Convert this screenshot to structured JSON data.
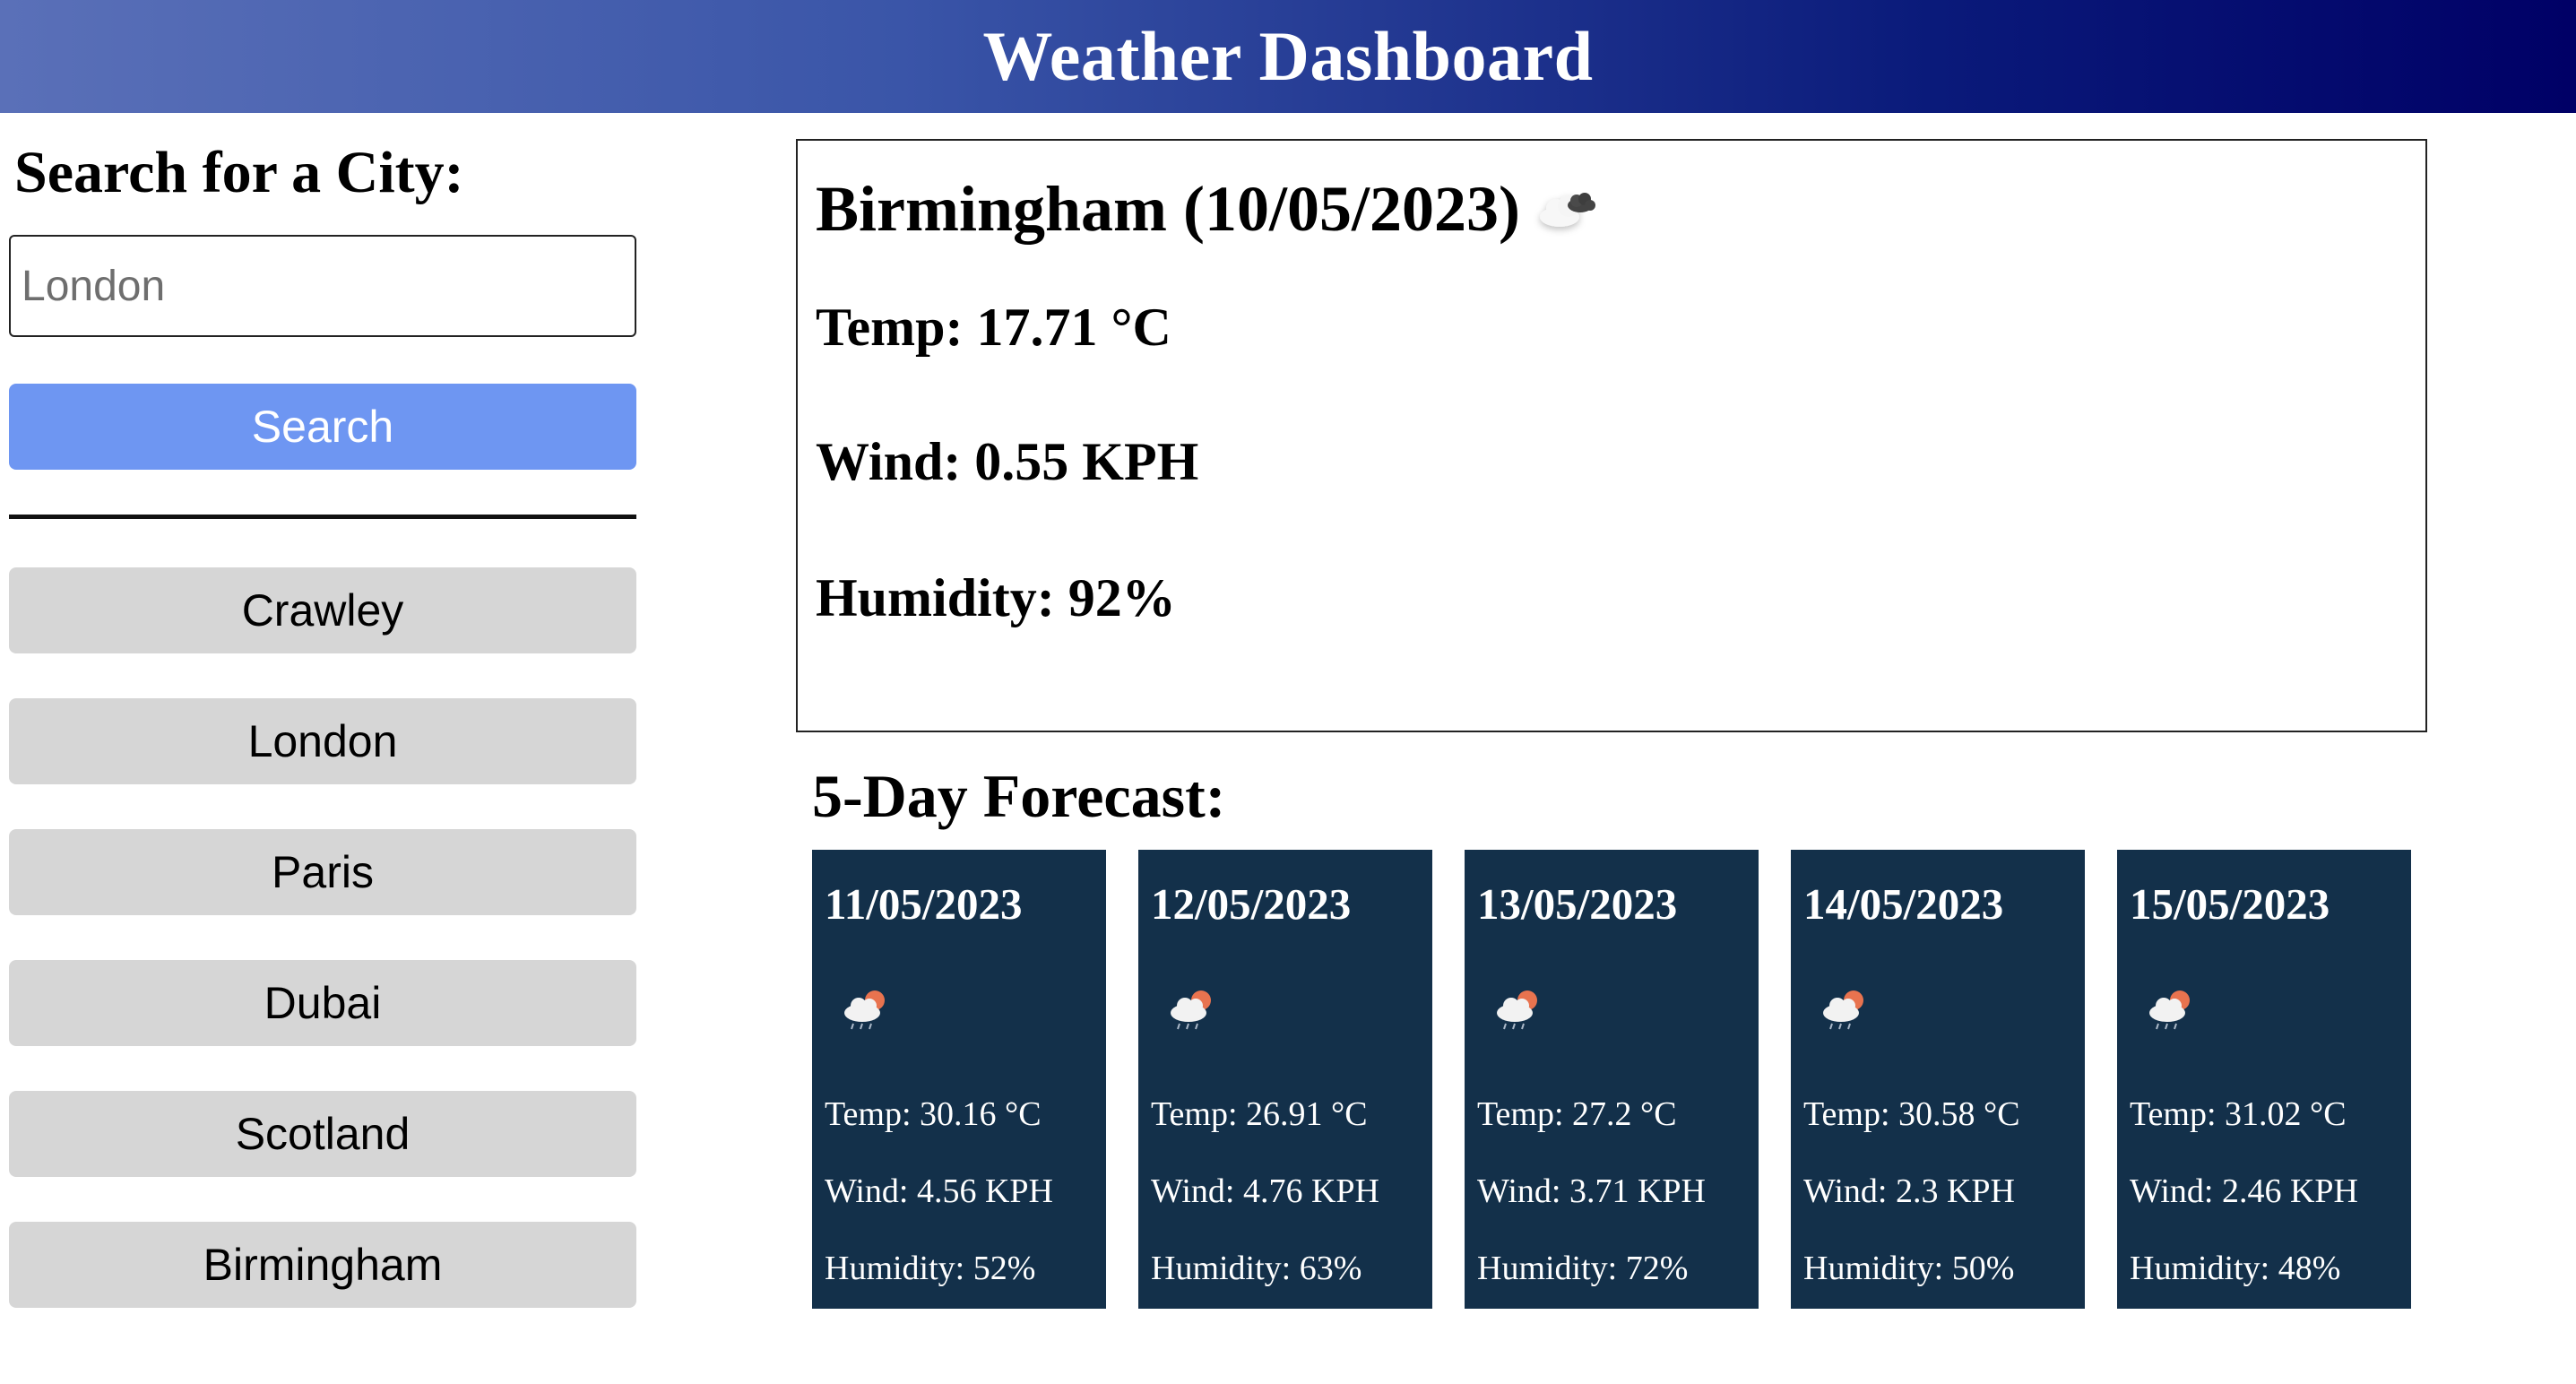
{
  "header": {
    "title": "Weather Dashboard"
  },
  "sidebar": {
    "heading": "Search for a City:",
    "search_placeholder": "London",
    "search_button": "Search",
    "history": [
      "Crawley",
      "London",
      "Paris",
      "Dubai",
      "Scotland",
      "Birmingham"
    ]
  },
  "current": {
    "title": "Birmingham (10/05/2023)",
    "icon": "cloud-icon",
    "temp": "Temp: 17.71 °C",
    "wind": "Wind: 0.55 KPH",
    "humidity": "Humidity: 92%"
  },
  "forecast": {
    "title": "5-Day Forecast:",
    "days": [
      {
        "date": "11/05/2023",
        "icon": "rain-sun-icon",
        "temp": "Temp: 30.16 °C",
        "wind": "Wind: 4.56 KPH",
        "humidity": "Humidity: 52%"
      },
      {
        "date": "12/05/2023",
        "icon": "rain-sun-icon",
        "temp": "Temp: 26.91 °C",
        "wind": "Wind: 4.76 KPH",
        "humidity": "Humidity: 63%"
      },
      {
        "date": "13/05/2023",
        "icon": "rain-sun-icon",
        "temp": "Temp: 27.2 °C",
        "wind": "Wind: 3.71 KPH",
        "humidity": "Humidity: 72%"
      },
      {
        "date": "14/05/2023",
        "icon": "rain-sun-icon",
        "temp": "Temp: 30.58 °C",
        "wind": "Wind: 2.3 KPH",
        "humidity": "Humidity: 50%"
      },
      {
        "date": "15/05/2023",
        "icon": "rain-sun-icon",
        "temp": "Temp: 31.02 °C",
        "wind": "Wind: 2.46 KPH",
        "humidity": "Humidity: 48%"
      }
    ]
  },
  "colors": {
    "header_gradient_start": "#5a70b8",
    "header_gradient_end": "#000066",
    "search_button": "#6e96f2",
    "history_button": "#d6d6d6",
    "forecast_card": "#13304a"
  }
}
